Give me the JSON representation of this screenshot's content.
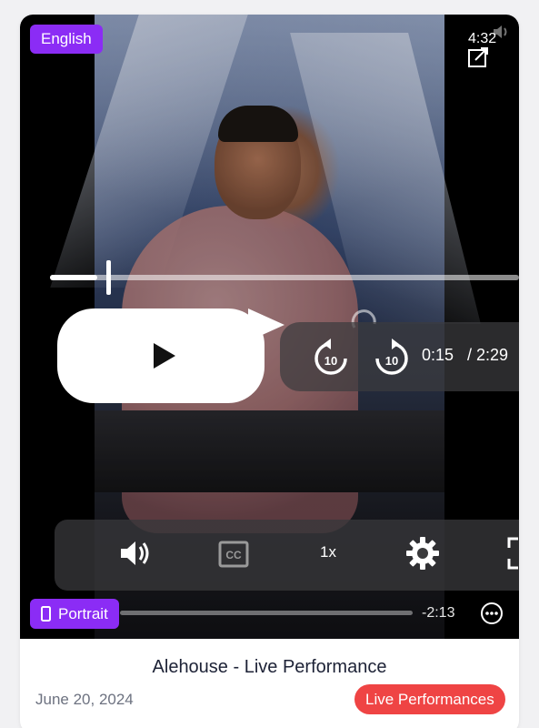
{
  "badge": {
    "language": "English",
    "orientation": "Portrait"
  },
  "video": {
    "duration": "4:32",
    "current_time": "0:15",
    "total_time": "/ 2:29",
    "remaining": "-2:13",
    "speed": "1x",
    "progress_fraction": 0.1
  },
  "card": {
    "title": "Alehouse - Live Performance",
    "date": "June 20, 2024",
    "category": "Live Performances"
  },
  "colors": {
    "accent_purple": "#8b2cf5",
    "tag_red": "#ef4444",
    "title_text": "#1d2236",
    "muted_text": "#6d7280"
  },
  "icons": {
    "play": "play-icon",
    "seek_back": "replay-10-icon",
    "seek_forward": "forward-10-icon",
    "volume": "volume-icon",
    "captions": "closed-captions-icon",
    "settings": "gear-icon",
    "fullscreen": "fullscreen-icon",
    "more": "more-options-icon",
    "external": "external-link-icon",
    "phone": "phone-icon"
  }
}
